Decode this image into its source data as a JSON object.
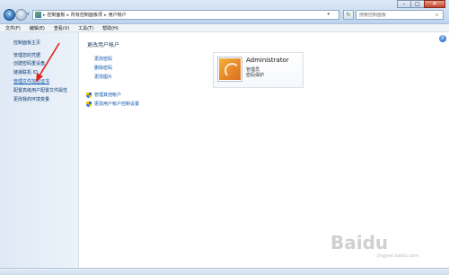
{
  "address_bar": {
    "breadcrumbs": [
      "控制面板",
      "所有控制面板项",
      "用户帐户"
    ],
    "search_placeholder": "搜索控制面板"
  },
  "menu": [
    "文件(F)",
    "编辑(E)",
    "查看(V)",
    "工具(T)",
    "帮助(H)"
  ],
  "sidebar": {
    "home": "控制面板主页",
    "items": [
      {
        "label": "管理您的凭据"
      },
      {
        "label": "创建密码重设盘"
      },
      {
        "label": "链接联机 ID"
      },
      {
        "label": "管理文件加密证书"
      },
      {
        "label": "配置高级用户配置文件属性"
      },
      {
        "label": "更改我的环境变量"
      }
    ]
  },
  "main": {
    "title": "更改用户帐户",
    "tasks": [
      "更改密码",
      "删除密码",
      "更改图片"
    ],
    "shield_tasks": [
      "管理其他帐户",
      "更改用户帐户控制设置"
    ]
  },
  "user": {
    "name": "Administrator",
    "role": "管理员",
    "status": "密码保护"
  },
  "watermark": {
    "brand": "Baidu",
    "sub": "jingyan.baidu.com"
  },
  "annotation_color": "#e0201b"
}
